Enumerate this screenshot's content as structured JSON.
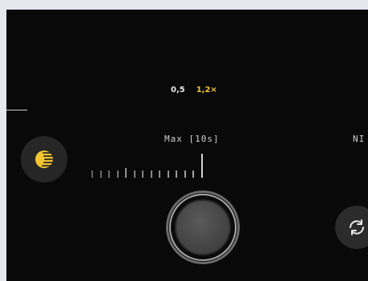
{
  "zoom": {
    "options": [
      "0,5",
      "1,2×"
    ],
    "active_index": 1
  },
  "exposure": {
    "label": "Max [10s]",
    "right_label": "NI",
    "ruler_ticks": 14
  },
  "controls": {
    "night_mode_icon": "moon-icon",
    "shutter_icon": "shutter-button",
    "flip_icon": "camera-flip-icon"
  },
  "colors": {
    "accent": "#f2c531",
    "background": "#090909"
  }
}
